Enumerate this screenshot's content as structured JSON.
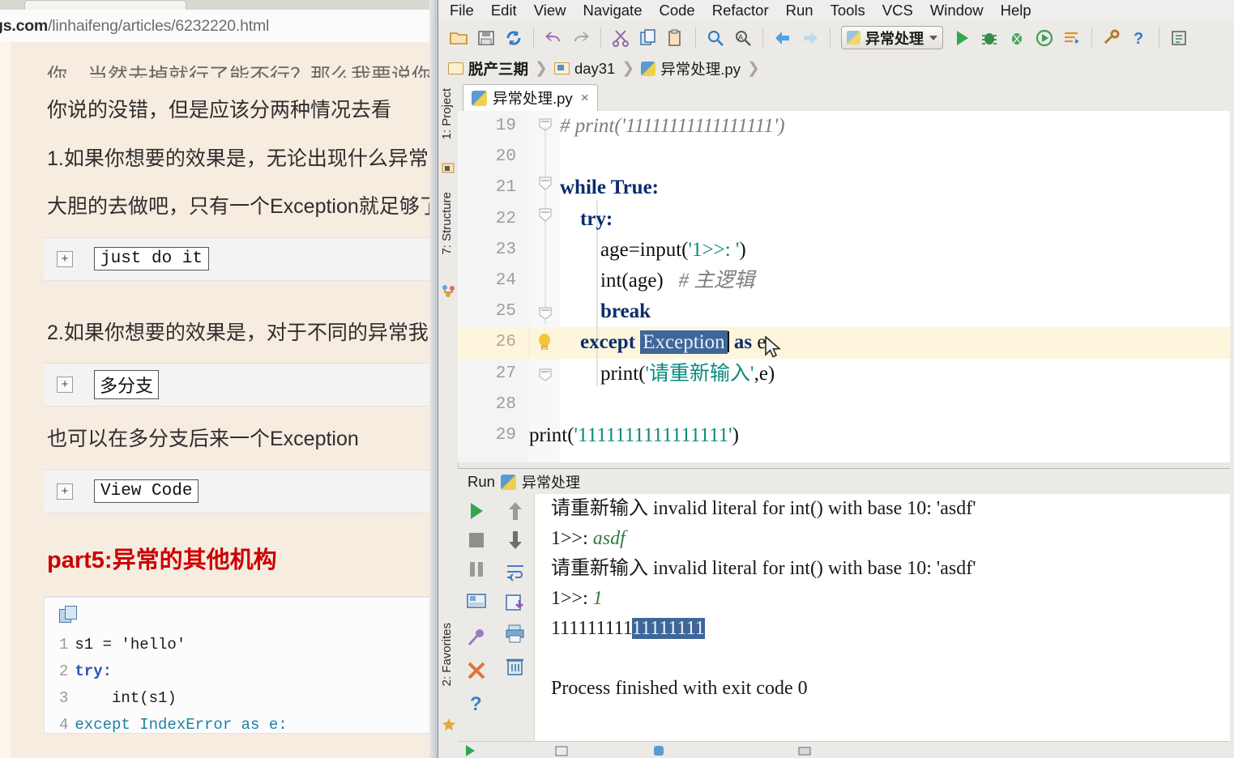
{
  "browser": {
    "url_domain": "gs.com",
    "url_path": "/linhaifeng/articles/6232220.html",
    "article": {
      "cut_line": "你，当然去掉就行了能不行？那么我要说你",
      "paragraphs": [
        "你说的没错，但是应该分两种情况去看",
        "1.如果你想要的效果是，无论出现什么异常",
        "大胆的去做吧，只有一个Exception就足够了",
        "2.如果你想要的效果是，对于不同的异常我",
        "也可以在多分支后来一个Exception"
      ],
      "code_toggles": [
        {
          "expand": "+",
          "label": "just do it"
        },
        {
          "expand": "+",
          "label": "多分支"
        },
        {
          "expand": "+",
          "label": "View Code"
        }
      ],
      "heading": {
        "prefix": "part5:",
        "text": "异常的其他机构"
      },
      "snippet": {
        "copy_icon": "copy-icon",
        "lines": [
          {
            "n": "1",
            "code": "s1 = 'hello'"
          },
          {
            "n": "2",
            "code": "try:"
          },
          {
            "n": "3",
            "code": "    int(s1)"
          },
          {
            "n": "4",
            "code": "except IndexError as e:"
          }
        ]
      }
    }
  },
  "ide": {
    "menu": [
      "File",
      "Edit",
      "View",
      "Navigate",
      "Code",
      "Refactor",
      "Run",
      "Tools",
      "VCS",
      "Window",
      "Help"
    ],
    "toolbar": {
      "icons": [
        "open-folder-icon",
        "save-all-icon",
        "sync-refresh-icon",
        "undo-icon",
        "redo-icon",
        "cut-icon",
        "copy-icon",
        "paste-icon",
        "find-icon",
        "replace-icon",
        "back-icon",
        "forward-icon"
      ],
      "run_config": {
        "label": "异常处理",
        "icon": "python-file-icon",
        "caret": "chevron-down-icon"
      },
      "right_icons": [
        "run-icon",
        "debug-icon",
        "debug-coverage-icon",
        "run-with-profiler-icon",
        "run-console-icon",
        "settings-wrench-icon",
        "help-icon",
        "save-commit-icon"
      ]
    },
    "breadcrumbs": [
      {
        "icon": "folder-icon",
        "label": "脱产三期"
      },
      {
        "icon": "folder-module-icon",
        "label": "day31"
      },
      {
        "icon": "python-file-icon",
        "label": "异常处理.py"
      }
    ],
    "left_rail": [
      {
        "label": "1: Project",
        "icon": "project-icon"
      },
      {
        "label": "7: Structure",
        "icon": "structure-icon"
      },
      {
        "label": "2: Favorites",
        "icon": "star-icon"
      }
    ],
    "file_tab": {
      "icon": "python-file-icon",
      "label": "异常处理.py",
      "close": "×"
    },
    "editor": {
      "highlight_line": 26,
      "bulb_icon": "intention-bulb-icon",
      "selection_text": "Exception",
      "lines": [
        {
          "n": "19",
          "fold": "fold-end",
          "segments": [
            {
              "t": "# print('11111111111111111')",
              "c": "cm"
            }
          ]
        },
        {
          "n": "20",
          "fold": "",
          "segments": [
            {
              "t": "",
              "c": ""
            }
          ]
        },
        {
          "n": "21",
          "fold": "fold-open",
          "segments": [
            {
              "t": "while True:",
              "c": "kw"
            }
          ]
        },
        {
          "n": "22",
          "fold": "fold-open",
          "segments": [
            {
              "t": "    try:",
              "c": "kw"
            }
          ]
        },
        {
          "n": "23",
          "fold": "",
          "segments": [
            {
              "t": "        age=input('1>>: ')",
              "c": "mix"
            }
          ]
        },
        {
          "n": "24",
          "fold": "",
          "segments": [
            {
              "t": "        int(age)   # 主逻辑",
              "c": "mix"
            }
          ]
        },
        {
          "n": "25",
          "fold": "fold-end",
          "segments": [
            {
              "t": "        break",
              "c": "kw"
            }
          ]
        },
        {
          "n": "26",
          "fold": "",
          "segments": [
            {
              "t": "    except Exception as e:",
              "c": "mix"
            }
          ]
        },
        {
          "n": "27",
          "fold": "fold-end",
          "segments": [
            {
              "t": "        print('请重新输入',e)",
              "c": "mix"
            }
          ]
        },
        {
          "n": "28",
          "fold": "",
          "segments": [
            {
              "t": "",
              "c": ""
            }
          ]
        },
        {
          "n": "29",
          "fold": "",
          "segments": [
            {
              "t": "print('1111111111111111')",
              "c": "mix"
            }
          ]
        }
      ]
    },
    "run_panel": {
      "title": "Run",
      "config_label": "异常处理",
      "config_icon": "python-file-icon",
      "tools_left": [
        "rerun-icon",
        "stop-icon",
        "pause-icon",
        "console-icon",
        "pin-tab-icon",
        "close-icon",
        "help-icon"
      ],
      "tools_right": [
        "up-arrow-icon",
        "down-arrow-icon",
        "soft-wrap-icon",
        "export-icon",
        "print-icon",
        "trash-icon"
      ],
      "console_lines": [
        {
          "text": "请重新输入 invalid literal for int() with base 10: 'asdf'",
          "style": "normal"
        },
        {
          "text": "1>>: ",
          "echo": "asdf",
          "style": "input"
        },
        {
          "text": "请重新输入 invalid literal for int() with base 10: 'asdf'",
          "style": "normal"
        },
        {
          "text": "1>>: ",
          "echo": "1",
          "style": "input"
        },
        {
          "text": "111111111",
          "selected": "11111111",
          "style": "selection"
        },
        {
          "text": "",
          "style": "normal"
        },
        {
          "text": "Process finished with exit code 0",
          "style": "normal"
        }
      ]
    }
  },
  "colors": {
    "ide_chrome": "#eceae7",
    "editor_bg": "#ffffff",
    "line_highlight": "#fdf6dd",
    "selection_blue": "#3e6699",
    "keyword": "#0b2c6e",
    "string": "#0b8a7d",
    "comment": "#7e7e7e",
    "heading_red": "#cc0000",
    "article_bg": "#f7ece0"
  }
}
